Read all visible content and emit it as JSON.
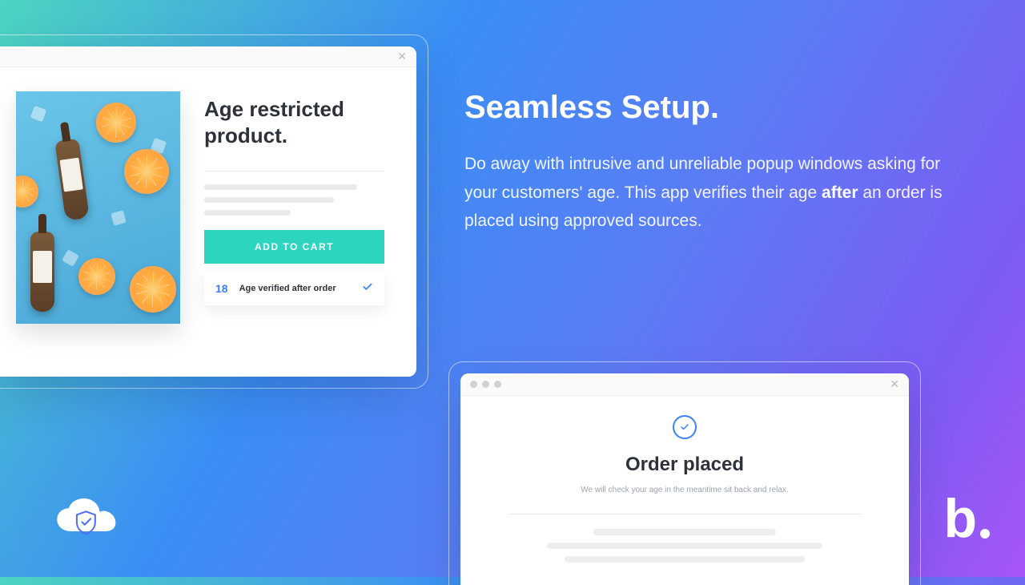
{
  "marketing": {
    "title": "Seamless Setup.",
    "body_pre": "Do away with intrusive and unreliable popup windows asking for your customers' age. This app verifies their age ",
    "body_bold": "after",
    "body_post": " an order is placed using approved sources."
  },
  "window1": {
    "product_title": "Age restricted product.",
    "add_to_cart": "ADD TO CART",
    "age_number": "18",
    "age_label": "Age verified after order"
  },
  "window2": {
    "title": "Order placed",
    "subtitle": "We will check your age in the meantime sit back and relax."
  },
  "brand_logo": "b"
}
